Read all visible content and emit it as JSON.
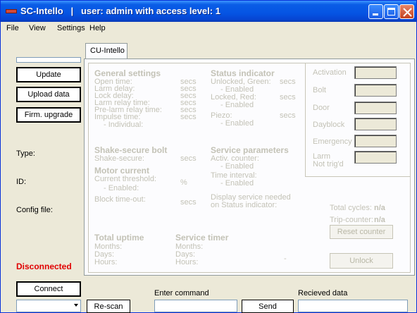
{
  "window": {
    "title": "SC-Intello   |   user: admin with access level: 1"
  },
  "menu": {
    "file": "File",
    "view": "View",
    "settings": "Settings",
    "help": "Help"
  },
  "left": {
    "update": "Update",
    "upload": "Upload data",
    "firm_upgrade": "Firm. upgrade",
    "type_label": "Type:",
    "id_label": "ID:",
    "config_label": "Config file:",
    "status": "Disconnected",
    "connect": "Connect"
  },
  "tab": {
    "label": "CU-Intello"
  },
  "general": {
    "title": "General settings",
    "open_time": "Open time:",
    "larm_delay": "Larm delay:",
    "lock_delay": "Lock delay:",
    "larm_relay": "Larm relay time:",
    "pre_larm": "Pre-larm relay time:",
    "impulse": "Impulse time:",
    "individual": "- Individual:",
    "unit": "secs"
  },
  "status_indicator": {
    "title": "Status indicator",
    "unlocked": "Unlocked, Green:",
    "enabled": "- Enabled",
    "locked": "Locked, Red:",
    "piezo": "Piezo:",
    "unit": "secs"
  },
  "shake": {
    "title": "Shake-secure bolt",
    "shake_secure": "Shake-secure:",
    "unit": "secs"
  },
  "service": {
    "title": "Service parameters",
    "activ_counter": "Activ. counter:",
    "enabled": "- Enabled",
    "time_interval": "Time interval:",
    "display_needed_1": "Display service needed",
    "display_needed_2": "on Status indicator:"
  },
  "motor": {
    "title": "Motor current",
    "current_threshold": "Current threshold:",
    "percent": "%",
    "enabled": "- Enabled:",
    "block_timeout": "Block time-out:",
    "unit": "secs"
  },
  "indicators": {
    "activation": "Activation",
    "bolt": "Bolt",
    "door": "Door",
    "dayblock": "Dayblock",
    "emergency": "Emergency",
    "larm_line1": "Larm",
    "larm_line2": "Not trig'd"
  },
  "counters": {
    "total_cycles_label": "Total cycles:",
    "total_cycles_value": "n/a",
    "trip_counter_label": "Trip-counter:",
    "trip_counter_value": "n/a",
    "reset": "Reset counter",
    "unlock": "Unlock",
    "dash": "-"
  },
  "uptime": {
    "title": "Total uptime",
    "months": "Months:",
    "days": "Days:",
    "hours": "Hours:"
  },
  "service_timer": {
    "title": "Service timer",
    "months": "Months:",
    "days": "Days:",
    "hours": "Hours:"
  },
  "bottom": {
    "rescan": "Re-scan",
    "enter_command": "Enter command",
    "send": "Send",
    "received": "Recieved data",
    "port_value": ""
  }
}
